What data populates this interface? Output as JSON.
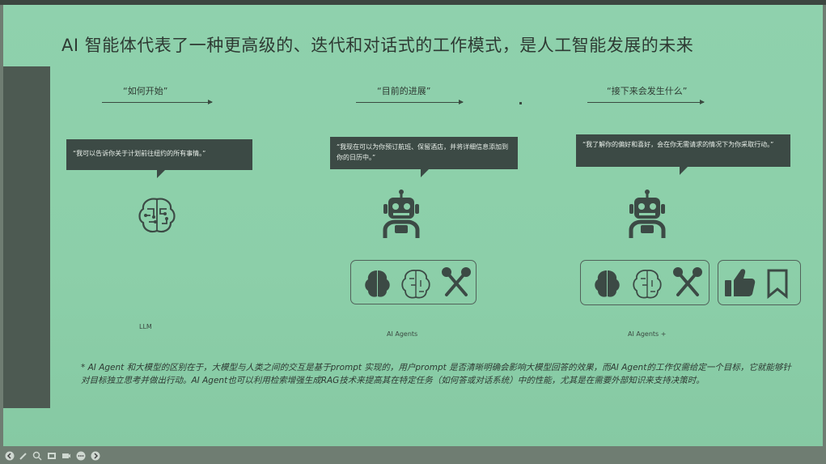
{
  "slide": {
    "title": "AI 智能体代表了一种更高级的、迭代和对话式的工作模式，是人工智能发展的未来",
    "stages": [
      {
        "label": "“如何开始”",
        "bubble": "“我可以告诉你关于计划前往纽约的所有事情。”",
        "caption": "LLM"
      },
      {
        "label": "“目前的进展”",
        "bubble": "“我现在可以为你预订航班、保留酒店，并将详细信息添加到你的日历中。”",
        "caption": "AI Agents"
      },
      {
        "label": "“接下来会发生什么”",
        "bubble": "“我了解你的偏好和喜好，会在你无需请求的情况下为你采取行动。”",
        "caption": "AI Agents +"
      }
    ],
    "note": "* AI Agent 和大模型的区别在于，大模型与人类之间的交互是基于prompt 实现的，用户prompt 是否清晰明确会影响大模型回答的效果，而AI Agent的工作仅需给定一个目标，它就能够针对目标独立思考并做出行动。AI Agent也可以利用检索增强生成RAG技术来提高其在特定任务（如何答或对话系统）中的性能，尤其是在需要外部知识来支持决策时。"
  },
  "icons": {
    "stage1": [
      "ai-brain-circuit-icon"
    ],
    "stage2": [
      "robot-icon",
      "brain-icon",
      "brain-circuit-icon",
      "tools-icon"
    ],
    "stage3": [
      "robot-icon",
      "brain-icon",
      "brain-circuit-icon",
      "tools-icon",
      "thumbs-up-icon",
      "bookmark-icon"
    ]
  },
  "controls": [
    "prev-icon",
    "pen-icon",
    "zoom-icon",
    "slides-icon",
    "camera-icon",
    "more-icon",
    "next-icon"
  ],
  "colors": {
    "slide_bg": "#8ccfa9",
    "dark": "#3c4a45",
    "text": "#2e3a33"
  }
}
